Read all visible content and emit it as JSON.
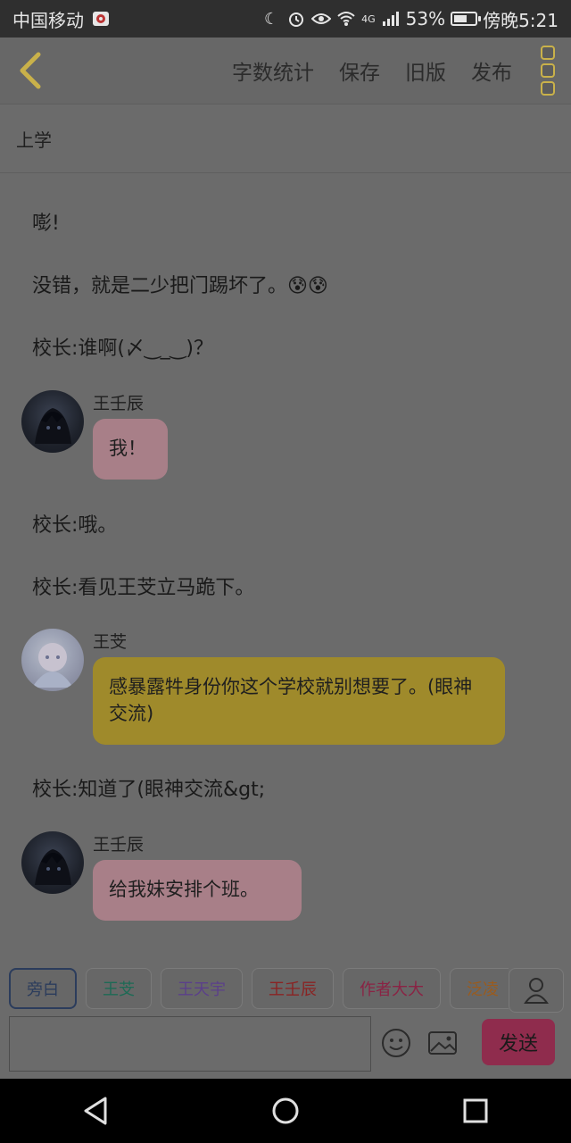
{
  "status": {
    "carrier": "中国移动",
    "network": "4G",
    "battery": "53%",
    "time": "傍晚5:21",
    "battery_level": 0.53
  },
  "toolbar": {
    "word_count": "字数统计",
    "save": "保存",
    "old_version": "旧版",
    "publish": "发布"
  },
  "story": {
    "title": "上学"
  },
  "messages": {
    "m1": "嘭!",
    "m2": "没错，就是二少把门踢坏了。😰😰",
    "m3": "校长:谁啊(〆‿_‿)？",
    "m4_speaker": "王壬辰",
    "m4_text": "我！",
    "m5": "校长:哦。",
    "m6": "校长:看见王芠立马跪下。",
    "m7_speaker": "王芠",
    "m7_text": "感暴露牪身份你这个学校就别想要了。(眼神交流)",
    "m8": "校长:知道了(眼神交流&gt;",
    "m9_speaker": "王壬辰",
    "m9_text": "给我妹安排个班。"
  },
  "characters": [
    {
      "label": "旁白",
      "color": "#2b3c5c",
      "selected": true
    },
    {
      "label": "王芠",
      "color": "#1d6a55",
      "selected": false
    },
    {
      "label": "王天宇",
      "color": "#5b3f8a",
      "selected": false
    },
    {
      "label": "王壬辰",
      "color": "#8a2323",
      "selected": false
    },
    {
      "label": "作者大大",
      "color": "#8a2344",
      "selected": false
    },
    {
      "label": "泛凌",
      "color": "#9a5b1d",
      "selected": false
    }
  ],
  "input": {
    "placeholder": "",
    "send": "发送"
  },
  "icons": {
    "back": "chevron-left-icon",
    "more": "more-vertical-icon",
    "emoji": "smiley-icon",
    "image": "image-icon",
    "user": "user-icon",
    "nav_back": "triangle-back-icon",
    "nav_home": "circle-home-icon",
    "nav_recent": "square-recent-icon"
  }
}
